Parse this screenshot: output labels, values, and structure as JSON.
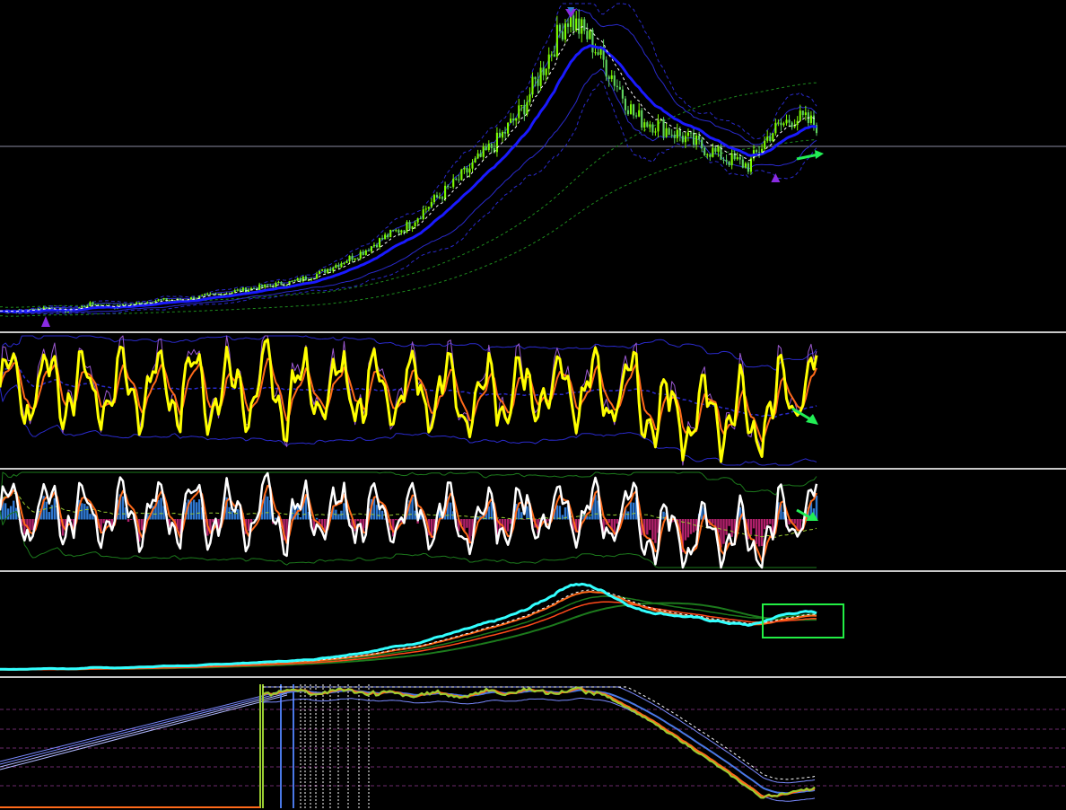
{
  "colors": {
    "background": "#000000",
    "separator": "#c8c8c8",
    "candle_up": "#7cfc00",
    "candle_down": "#5fd35f",
    "ma_blue": "#1a1aff",
    "band_blue": "#2a2acc",
    "dotted_white": "#ffffff",
    "trend_green": "#1e8c1e",
    "yellow": "#ffff00",
    "orange": "#ff6a1a",
    "purple": "#9b59d0",
    "white": "#ffffff",
    "hist_up": "#2f78d0",
    "hist_down": "#b0206a",
    "cyan": "#33ffff",
    "dark_green": "#1c7a1c",
    "olive": "#9acd32",
    "steel_blue": "#4a78e6",
    "magenta_grid": "#6b2a6b",
    "arrow_green": "#22ee55",
    "highlight_box": "#22ee44",
    "horizontal_level": "#8a8aa0"
  },
  "chart_data": [
    {
      "type": "line",
      "pane": "price",
      "series": [
        {
          "role": "close",
          "style": "candlesticks"
        },
        {
          "role": "moving-average",
          "style": "thick-blue"
        },
        {
          "role": "moving-average",
          "style": "white-dashed"
        },
        {
          "role": "envelope",
          "style": "thin-blue"
        },
        {
          "role": "envelope",
          "style": "dotted-blue"
        },
        {
          "role": "long-trend",
          "style": "green-dashed"
        }
      ],
      "close": [
        1.0,
        1.0,
        1.1,
        1.0,
        1.2,
        1.1,
        1.2,
        1.3,
        1.3,
        1.4,
        1.5,
        1.6,
        1.7,
        1.8,
        2.0,
        2.3,
        2.6,
        3.0,
        3.3,
        3.9,
        4.4,
        5.0,
        5.6,
        6.4,
        7.6,
        8.9,
        8.3,
        7.3,
        6.2,
        6.0,
        5.7,
        5.4,
        5.1,
        4.9,
        5.8,
        6.2,
        6.0
      ],
      "markers": [
        "arrow-down-top",
        "arrow-up-bottom",
        "arrow-right-green"
      ],
      "grid": false,
      "ylabel": "",
      "xlabel": ""
    },
    {
      "type": "line",
      "pane": "oscillator-1",
      "series": [
        {
          "role": "main",
          "style": "yellow"
        },
        {
          "role": "signal",
          "style": "orange"
        },
        {
          "role": "secondary",
          "style": "purple"
        },
        {
          "role": "bands",
          "style": "blue"
        }
      ],
      "markers": [
        "arrow-down-right-green"
      ]
    },
    {
      "type": "bar",
      "pane": "histogram",
      "series": [
        {
          "role": "histogram",
          "style": "blue-up-magenta-down"
        },
        {
          "role": "main",
          "style": "white"
        },
        {
          "role": "signal",
          "style": "orange"
        },
        {
          "role": "bands",
          "style": "green"
        }
      ],
      "markers": [
        "arrow-down-right-green"
      ]
    },
    {
      "type": "line",
      "pane": "trend",
      "series": [
        {
          "role": "main",
          "style": "cyan"
        },
        {
          "role": "fast",
          "style": "orange"
        },
        {
          "role": "slow",
          "style": "dark-green"
        }
      ],
      "annotations": [
        "highlight-box"
      ]
    },
    {
      "type": "line",
      "pane": "normalized",
      "series": [
        {
          "role": "main",
          "style": "olive"
        },
        {
          "role": "signal",
          "style": "orange"
        },
        {
          "role": "average",
          "style": "steel-blue"
        },
        {
          "role": "upper",
          "style": "white-dotted"
        }
      ],
      "grid": true
    }
  ]
}
